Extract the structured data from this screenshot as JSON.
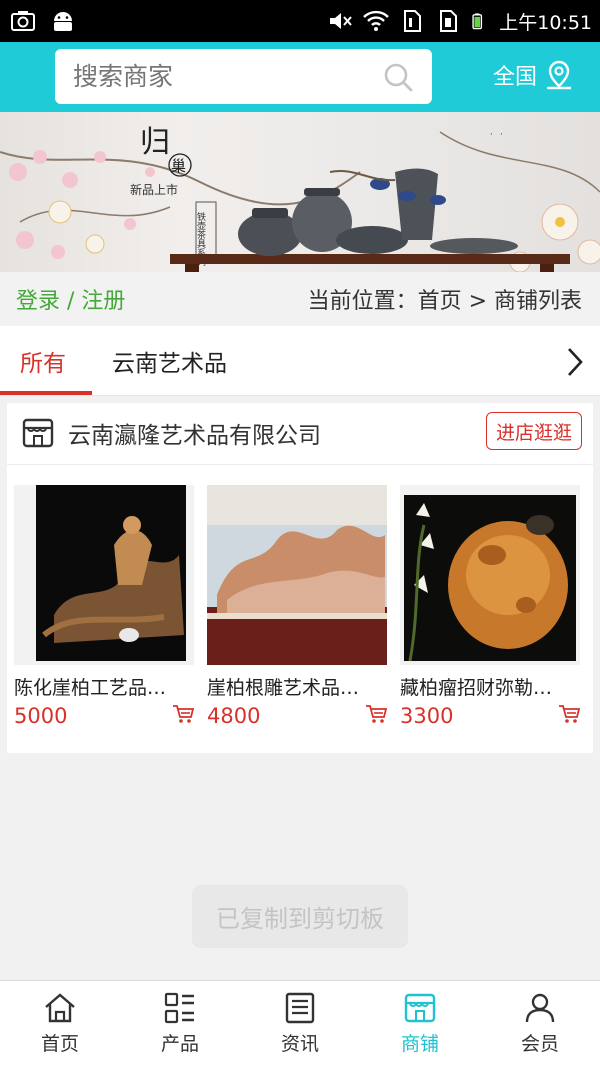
{
  "status_bar": {
    "time": "上午10:51",
    "icons": [
      "camera-icon",
      "android-icon",
      "mute-icon",
      "wifi-icon",
      "sim1-icon",
      "sim2-icon",
      "battery-icon"
    ]
  },
  "header": {
    "search_placeholder": "搜索商家",
    "region_label": "全国",
    "accent_color": "#1fcbd6"
  },
  "banner": {
    "headline": "归",
    "tag": "巢",
    "subtitle": "新品上市",
    "vertical_text": "铁壶茶具系列"
  },
  "location_bar": {
    "login_label": "登录 / 注册",
    "breadcrumb": "当前位置：首页 > 商铺列表"
  },
  "tabs": [
    {
      "label": "所有",
      "active": true
    },
    {
      "label": "云南艺术品",
      "active": false
    }
  ],
  "shop": {
    "name": "云南瀛隆艺术品有限公司",
    "visit_button": "进店逛逛",
    "products": [
      {
        "title": "陈化崖柏工艺品…",
        "price": "5000"
      },
      {
        "title": "崖柏根雕艺术品…",
        "price": "4800"
      },
      {
        "title": "藏柏瘤招财弥勒…",
        "price": "3300"
      }
    ]
  },
  "toast": "已复制到剪切板",
  "bottom_nav": [
    {
      "label": "首页",
      "icon": "home-icon",
      "active": false
    },
    {
      "label": "产品",
      "icon": "grid-list-icon",
      "active": false
    },
    {
      "label": "资讯",
      "icon": "news-icon",
      "active": false
    },
    {
      "label": "商铺",
      "icon": "shop-icon",
      "active": true
    },
    {
      "label": "会员",
      "icon": "user-icon",
      "active": false
    }
  ],
  "colors": {
    "accent": "#1fcbd6",
    "price_red": "#d9312a",
    "login_green": "#44a83a"
  }
}
